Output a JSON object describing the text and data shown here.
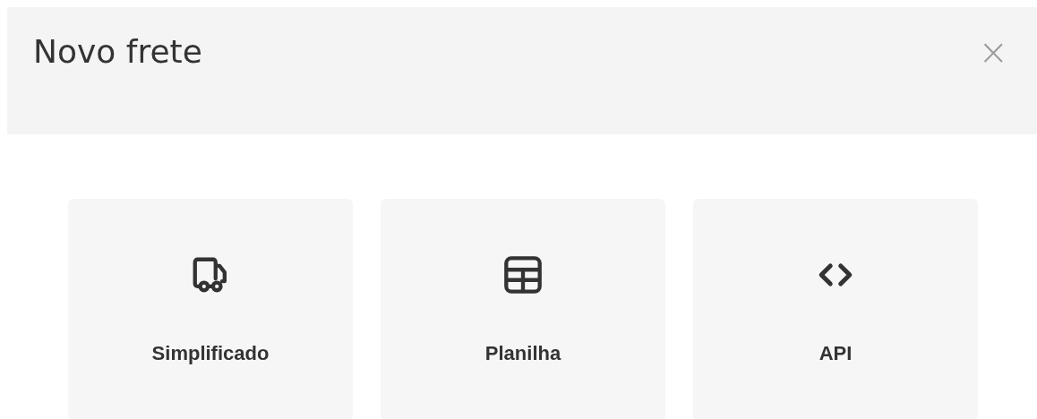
{
  "dialog": {
    "title": "Novo frete",
    "close": "×"
  },
  "options": [
    {
      "kind": "truck",
      "label": "Simplificado"
    },
    {
      "kind": "table",
      "label": "Planilha"
    },
    {
      "kind": "code",
      "label": "API"
    }
  ]
}
